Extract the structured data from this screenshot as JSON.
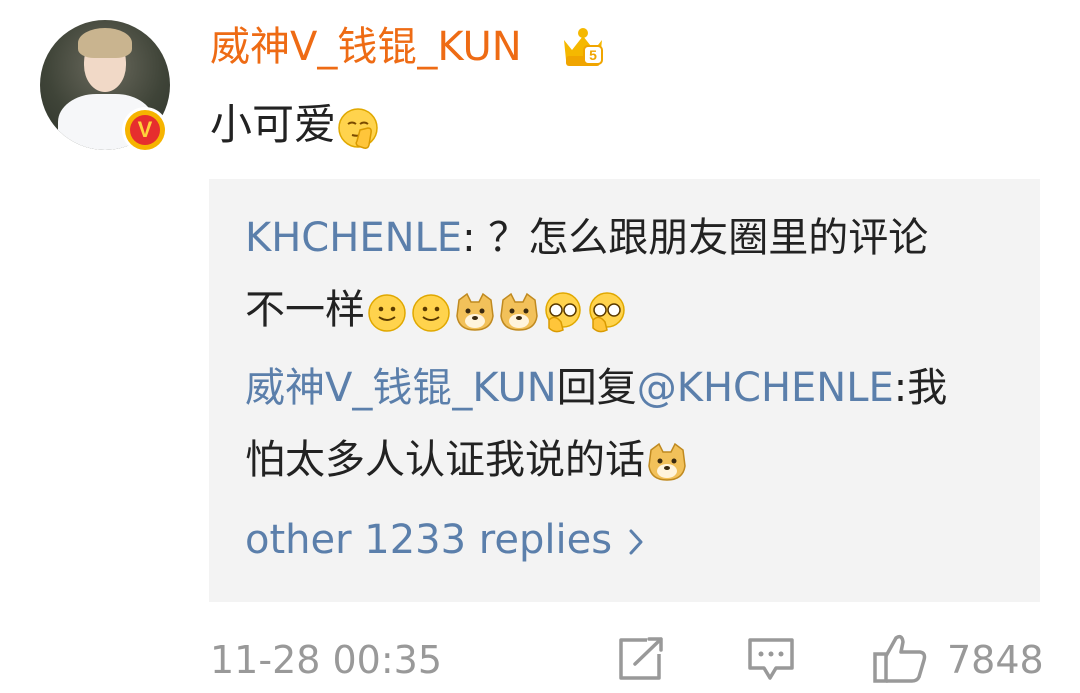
{
  "comment": {
    "username": "威神V_钱锟_KUN",
    "text": "小可爱",
    "emoji": "shush-emoji",
    "badges": {
      "level": "5",
      "verified": "V"
    }
  },
  "replies": [
    {
      "author": "KHCHENLE",
      "separator": ": ",
      "text_line1": "？怎么跟朋友圈里的评论",
      "text_line2": "不一样",
      "emojis": [
        "smile-emoji",
        "smile-emoji",
        "doge-emoji",
        "doge-emoji",
        "facepalm-emoji",
        "facepalm-emoji"
      ]
    },
    {
      "author": "威神V_钱锟_KUN",
      "reply_word": "回复",
      "mention": "@KHCHENLE",
      "separator": ":",
      "text_line1_tail": "我",
      "text_line2": "怕太多人认证我说的话",
      "emojis": [
        "doge-emoji"
      ]
    }
  ],
  "more_replies_label": "other 1233 replies",
  "footer": {
    "timestamp": "11-28 00:35",
    "likes": "7848"
  },
  "colors": {
    "username": "#ee6b14",
    "link": "#5b7fab",
    "reply_bg": "#f3f3f3",
    "muted": "#999999"
  }
}
